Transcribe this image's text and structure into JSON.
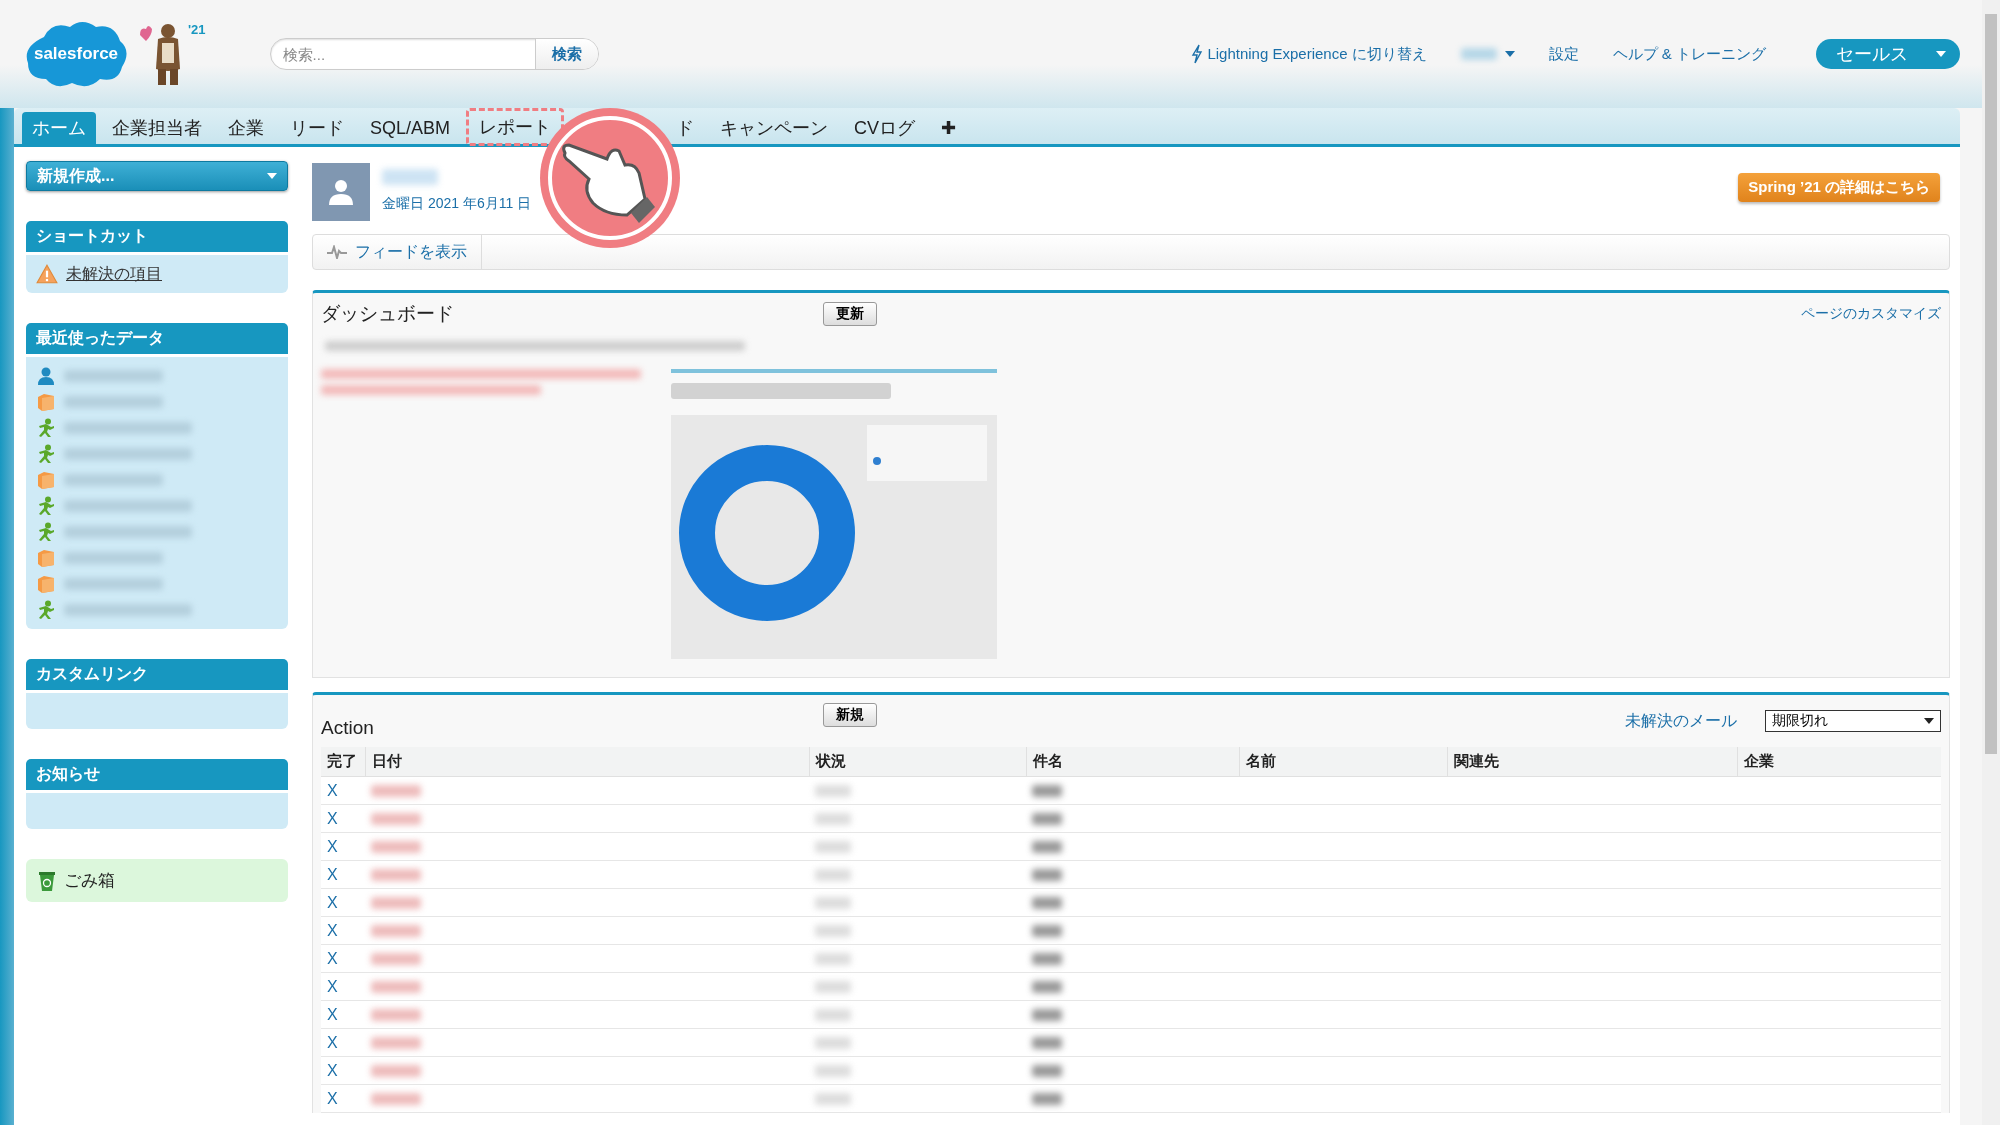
{
  "header": {
    "logo": "salesforce",
    "release_badge": "'21",
    "search": {
      "placeholder": "検索...",
      "button": "検索"
    },
    "links": [
      {
        "kind": "lightning",
        "label": "Lightning Experience に切り替え"
      },
      {
        "kind": "user_menu"
      },
      {
        "kind": "link",
        "label": "設定"
      },
      {
        "kind": "link",
        "label": "ヘルプ & トレーニング"
      }
    ],
    "app_menu": "セールス"
  },
  "tabs": [
    {
      "label": "ホーム",
      "selected": true,
      "highlighted": false
    },
    {
      "label": "企業担当者",
      "selected": false,
      "highlighted": false
    },
    {
      "label": "企業",
      "selected": false,
      "highlighted": false
    },
    {
      "label": "リード",
      "selected": false,
      "highlighted": false
    },
    {
      "label": "SQL/ABM",
      "selected": false,
      "highlighted": false
    },
    {
      "label": "レポート",
      "selected": false,
      "highlighted": true
    },
    {
      "label": "ド",
      "selected": false,
      "highlighted": false
    },
    {
      "label": "キャンペーン",
      "selected": false,
      "highlighted": false
    },
    {
      "label": "CVログ",
      "selected": false,
      "highlighted": false
    },
    {
      "label": "✚",
      "selected": false,
      "highlighted": false
    }
  ],
  "sidebar": {
    "create_button": "新規作成...",
    "sections": [
      {
        "title": "ショートカット",
        "items": [
          {
            "kind": "warning",
            "label": "未解決の項目"
          }
        ]
      },
      {
        "title": "最近使ったデータ",
        "items": [
          {
            "kind": "contact"
          },
          {
            "kind": "account"
          },
          {
            "kind": "lead"
          },
          {
            "kind": "lead"
          },
          {
            "kind": "account"
          },
          {
            "kind": "lead"
          },
          {
            "kind": "lead"
          },
          {
            "kind": "account"
          },
          {
            "kind": "account"
          },
          {
            "kind": "lead"
          }
        ]
      },
      {
        "title": "カスタムリンク"
      },
      {
        "title": "お知らせ"
      }
    ],
    "recycle_bin": "ごみ箱"
  },
  "main": {
    "profile": {
      "date": "金曜日 2021 年6月11 日"
    },
    "release_button": "Spring ’21 の詳細はこちら",
    "feed_toggle": "フィードを表示",
    "dashboard": {
      "title": "ダッシュボード",
      "refresh_button": "更新",
      "customize_link": "ページのカスタマイズ"
    },
    "actions": {
      "title": "Action",
      "new_button": "新規",
      "mail_link": "未解決のメール",
      "filter": "期限切れ",
      "columns": [
        "完了",
        "日付",
        "状況",
        "件名",
        "名前",
        "関連先",
        "企業"
      ],
      "rows": [
        {
          "action": "X"
        },
        {
          "action": "X"
        },
        {
          "action": "X"
        },
        {
          "action": "X"
        },
        {
          "action": "X"
        },
        {
          "action": "X"
        },
        {
          "action": "X"
        },
        {
          "action": "X"
        },
        {
          "action": "X"
        },
        {
          "action": "X"
        },
        {
          "action": "X"
        },
        {
          "action": "X"
        }
      ]
    }
  }
}
